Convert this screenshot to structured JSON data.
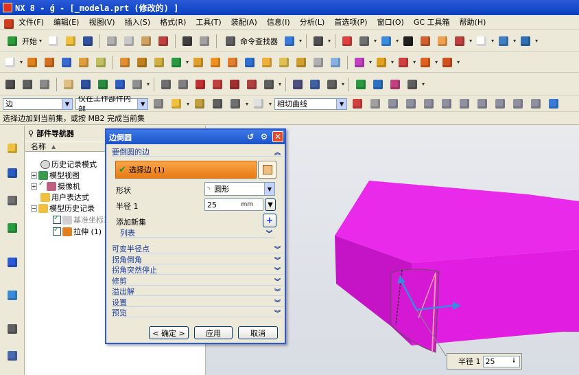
{
  "title": "NX 8 - ǵ - [_modela.prt (修改的) ]",
  "menu": [
    "文件(F)",
    "编辑(E)",
    "视图(V)",
    "插入(S)",
    "格式(R)",
    "工具(T)",
    "装配(A)",
    "信息(I)",
    "分析(L)",
    "首选项(P)",
    "窗口(O)",
    "GC 工具箱",
    "帮助(H)"
  ],
  "toolbar": {
    "start_label": "开始",
    "command_finder_label": "命令查找器"
  },
  "selection_bar": {
    "filter_value": "边",
    "scope_value": "仅在工作部件内部",
    "curve_rule_value": "相切曲线"
  },
  "cue_line": "选择边加到当前集，或按 MB2 完成当前集",
  "navigator": {
    "title": "部件导航器",
    "column_name": "名称",
    "items": [
      {
        "label": "历史记录模式"
      },
      {
        "label": "模型视图"
      },
      {
        "label": "摄像机"
      },
      {
        "label": "用户表达式"
      },
      {
        "label": "模型历史记录"
      },
      {
        "label": "基准坐标系"
      },
      {
        "label": "拉伸 (1)"
      }
    ]
  },
  "dialog": {
    "title": "边倒圆",
    "section_edge": "要倒圆的边",
    "select_edge_label": "选择边 (1)",
    "shape_label": "形状",
    "shape_value": "圆形",
    "radius_label": "半径 1",
    "radius_value": "25",
    "radius_unit": "mm",
    "add_set_label": "添加新集",
    "list_label": "列表",
    "collapsed_sections": [
      "可变半径点",
      "拐角倒角",
      "拐角突然停止",
      "修剪",
      "溢出解",
      "设置",
      "预览"
    ],
    "ok_label": "< 确定 >",
    "apply_label": "应用",
    "cancel_label": "取消"
  },
  "viewport": {
    "radius_popup_label": "半径 1",
    "radius_popup_value": "25",
    "body_color": "#e11de1"
  },
  "colors": {
    "title_bar": "#0a3fbe",
    "accent_orange": "#e87a12",
    "check_green": "#21a121"
  }
}
